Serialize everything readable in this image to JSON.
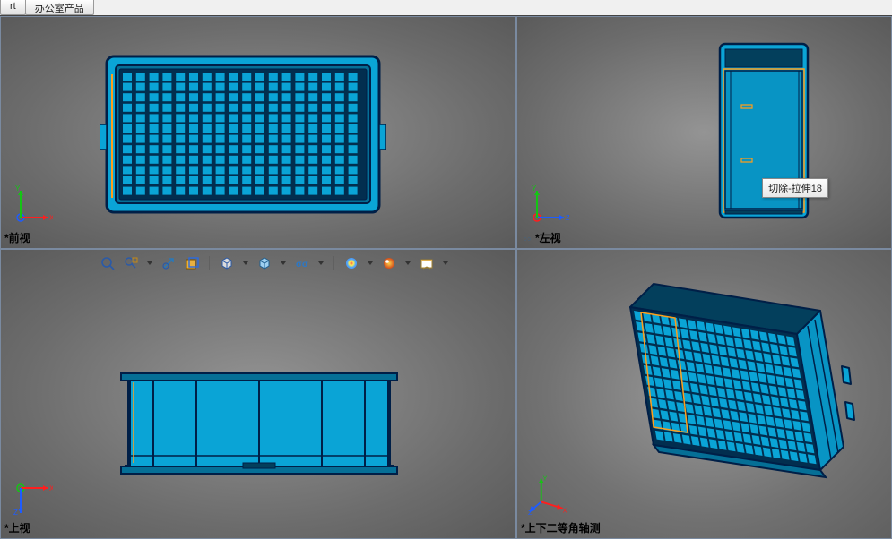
{
  "tabs": [
    "rt",
    "办公室产品"
  ],
  "viewports": {
    "tl": {
      "label": "*前视",
      "linked": false
    },
    "tr": {
      "label": "*左视",
      "linked": true
    },
    "bl": {
      "label": "*上视",
      "linked": false
    },
    "br": {
      "label": "*上下二等角轴测",
      "linked": false
    }
  },
  "tooltip": "切除-拉伸18",
  "hud_icons": [
    "zoom-fit-icon",
    "zoom-area-icon",
    "zoom-prev-icon",
    "section-icon",
    "view-orient-icon",
    "display-style-icon",
    "hide-show-icon",
    "edit-appearance-icon",
    "apply-scene-icon",
    "view-settings-icon"
  ],
  "triad": {
    "x": "X",
    "y": "Y",
    "z": "Z"
  },
  "colors": {
    "model_fill": "#0aa4d6",
    "model_edge": "#001f47",
    "highlight": "#ff9e1a",
    "axis_x": "#ff1e1e",
    "axis_y": "#14c514",
    "axis_z": "#1e5cff"
  }
}
